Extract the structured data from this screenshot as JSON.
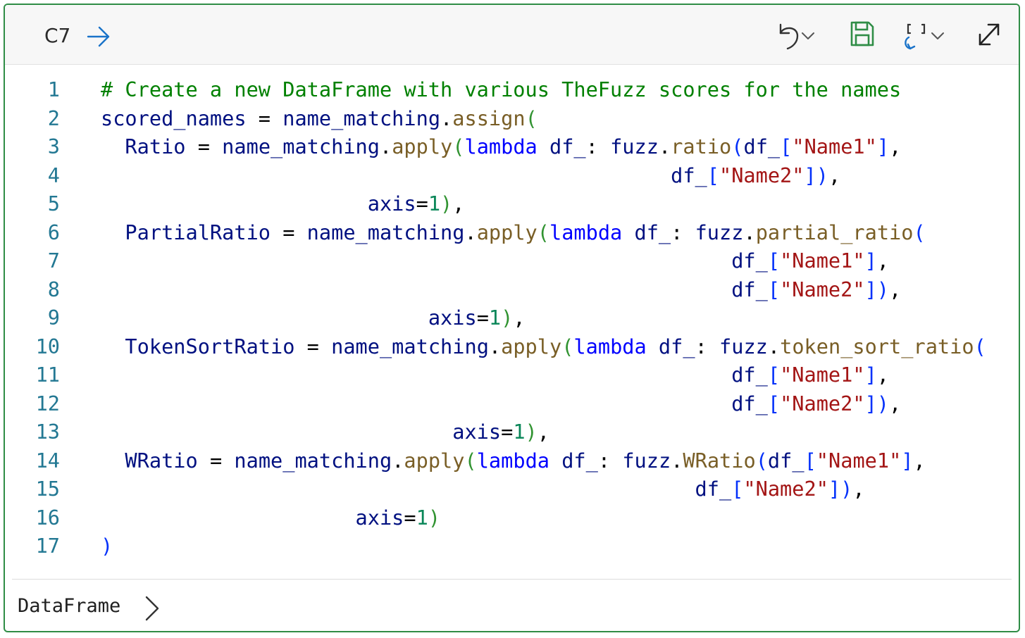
{
  "header": {
    "cell_ref": "C7",
    "icons": [
      "arrow-right-icon",
      "undo-icon",
      "chevron-down-icon",
      "save-icon",
      "refresh-brackets-icon",
      "expand-icon"
    ],
    "save_color": "#2f8d46"
  },
  "code": {
    "line_numbers": [
      "1",
      "2",
      "3",
      "4",
      "5",
      "6",
      "7",
      "8",
      "9",
      "10",
      "11",
      "12",
      "13",
      "14",
      "15",
      "16",
      "17"
    ],
    "lines": [
      [
        "# Create a new DataFrame with various TheFuzz scores for the names"
      ],
      [
        "scored_names",
        " = ",
        "name_matching",
        ".",
        "assign",
        "("
      ],
      [
        "  Ratio",
        " = ",
        "name_matching",
        ".",
        "apply",
        "(",
        "lambda",
        " df_",
        ": ",
        "fuzz",
        ".",
        "ratio",
        "(",
        "df_",
        "[",
        "\"Name1\"",
        "]",
        ","
      ],
      [
        "                                               ",
        "df_",
        "[",
        "\"Name2\"",
        "]",
        ")",
        ","
      ],
      [
        "                      ",
        "axis",
        "=",
        "1",
        ")",
        ","
      ],
      [
        "  PartialRatio",
        " = ",
        "name_matching",
        ".",
        "apply",
        "(",
        "lambda",
        " df_",
        ": ",
        "fuzz",
        ".",
        "partial_ratio",
        "("
      ],
      [
        "                                                    ",
        "df_",
        "[",
        "\"Name1\"",
        "]",
        ","
      ],
      [
        "                                                    ",
        "df_",
        "[",
        "\"Name2\"",
        "]",
        ")",
        ","
      ],
      [
        "                           ",
        "axis",
        "=",
        "1",
        ")",
        ","
      ],
      [
        "  TokenSortRatio",
        " = ",
        "name_matching",
        ".",
        "apply",
        "(",
        "lambda",
        " df_",
        ": ",
        "fuzz",
        ".",
        "token_sort_ratio",
        "("
      ],
      [
        "                                                    ",
        "df_",
        "[",
        "\"Name1\"",
        "]",
        ","
      ],
      [
        "                                                    ",
        "df_",
        "[",
        "\"Name2\"",
        "]",
        ")",
        ","
      ],
      [
        "                             ",
        "axis",
        "=",
        "1",
        ")",
        ","
      ],
      [
        "  WRatio",
        " = ",
        "name_matching",
        ".",
        "apply",
        "(",
        "lambda",
        " df_",
        ": ",
        "fuzz",
        ".",
        "WRatio",
        "(",
        "df_",
        "[",
        "\"Name1\"",
        "]",
        ","
      ],
      [
        "                                                 ",
        "df_",
        "[",
        "\"Name2\"",
        "]",
        ")",
        ","
      ],
      [
        "                     ",
        "axis",
        "=",
        "1",
        ")"
      ],
      [
        ")"
      ]
    ],
    "classes": [
      [
        "cm"
      ],
      [
        "",
        "pl",
        "",
        "pl",
        "fn",
        "b2"
      ],
      [
        "",
        "pl",
        "",
        "pl",
        "fn",
        "b2",
        "kw",
        "",
        "pl",
        "",
        "pl",
        "fn",
        "b1",
        "",
        "b1",
        "st",
        "b1",
        "pl"
      ],
      [
        "",
        "",
        "b1",
        "st",
        "b1",
        "b1",
        "pl"
      ],
      [
        "",
        "",
        "pl",
        "nu",
        "b2",
        "pl"
      ],
      [
        "",
        "pl",
        "",
        "pl",
        "fn",
        "b2",
        "kw",
        "",
        "pl",
        "",
        "pl",
        "fn",
        "b1"
      ],
      [
        "",
        "",
        "b1",
        "st",
        "b1",
        "pl"
      ],
      [
        "",
        "",
        "b1",
        "st",
        "b1",
        "b1",
        "pl"
      ],
      [
        "",
        "",
        "pl",
        "nu",
        "b2",
        "pl"
      ],
      [
        "",
        "pl",
        "",
        "pl",
        "fn",
        "b2",
        "kw",
        "",
        "pl",
        "",
        "pl",
        "fn",
        "b1"
      ],
      [
        "",
        "",
        "b1",
        "st",
        "b1",
        "pl"
      ],
      [
        "",
        "",
        "b1",
        "st",
        "b1",
        "b1",
        "pl"
      ],
      [
        "",
        "",
        "pl",
        "nu",
        "b2",
        "pl"
      ],
      [
        "",
        "pl",
        "",
        "pl",
        "fn",
        "b2",
        "kw",
        "",
        "pl",
        "",
        "pl",
        "fn",
        "b1",
        "",
        "b1",
        "st",
        "b1",
        "pl"
      ],
      [
        "",
        "",
        "b1",
        "st",
        "b1",
        "b1",
        "pl"
      ],
      [
        "",
        "",
        "pl",
        "nu",
        "b2"
      ],
      [
        "b1"
      ]
    ]
  },
  "footer": {
    "output_type": "DataFrame"
  }
}
